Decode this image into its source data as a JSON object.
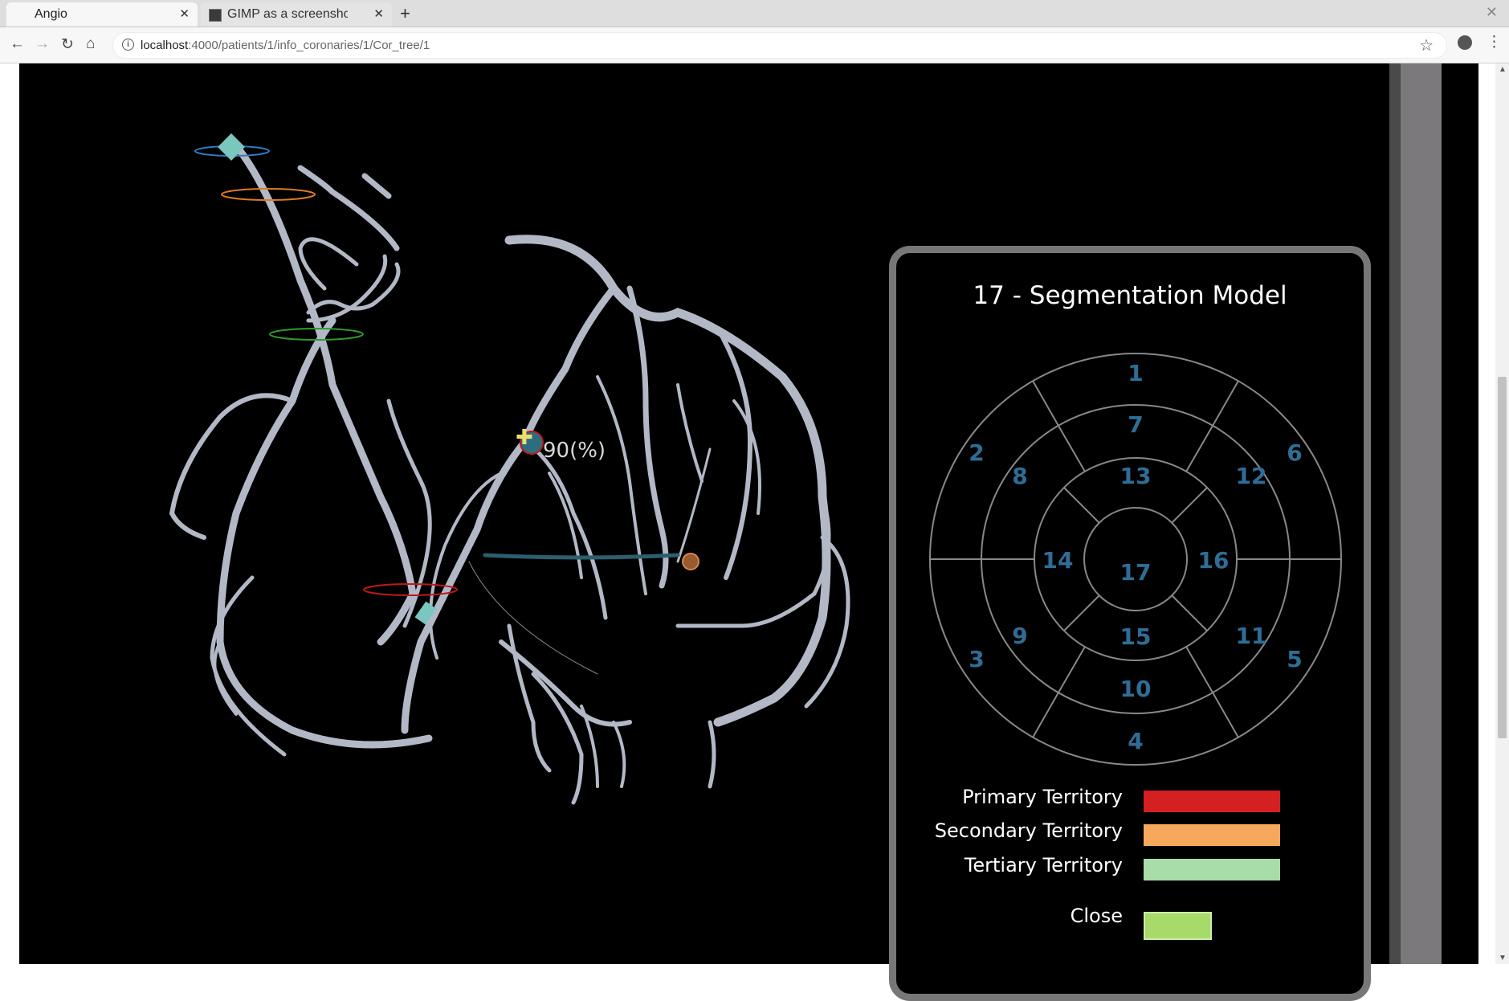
{
  "browser": {
    "tabs": [
      {
        "title": "Angio",
        "active": true
      },
      {
        "title": "GIMP as a screenshot t",
        "active": false
      }
    ],
    "new_tab_symbol": "+",
    "url_host": "localhost",
    "url_path": ":4000/patients/1/info_coronaries/1/Cor_tree/1",
    "icons": [
      "back-icon",
      "forward-icon",
      "reload-icon",
      "home-icon",
      "info-icon",
      "star-icon",
      "account-icon",
      "menu-icon"
    ]
  },
  "viewer": {
    "stenosis_label": "90(%)"
  },
  "segmentation_panel": {
    "title": "17 - Segmentation Model",
    "segments": [
      "1",
      "2",
      "3",
      "4",
      "5",
      "6",
      "7",
      "8",
      "9",
      "10",
      "11",
      "12",
      "13",
      "14",
      "15",
      "16",
      "17"
    ],
    "segment_color": "#2e6d96",
    "legend": [
      {
        "label": "Primary Territory",
        "color": "#d42020"
      },
      {
        "label": "Secondary Territory",
        "color": "#f6a95c"
      },
      {
        "label": "Tertiary Territory",
        "color": "#a8dca8"
      }
    ],
    "close_label": "Close",
    "close_color": "#a8da6a"
  }
}
